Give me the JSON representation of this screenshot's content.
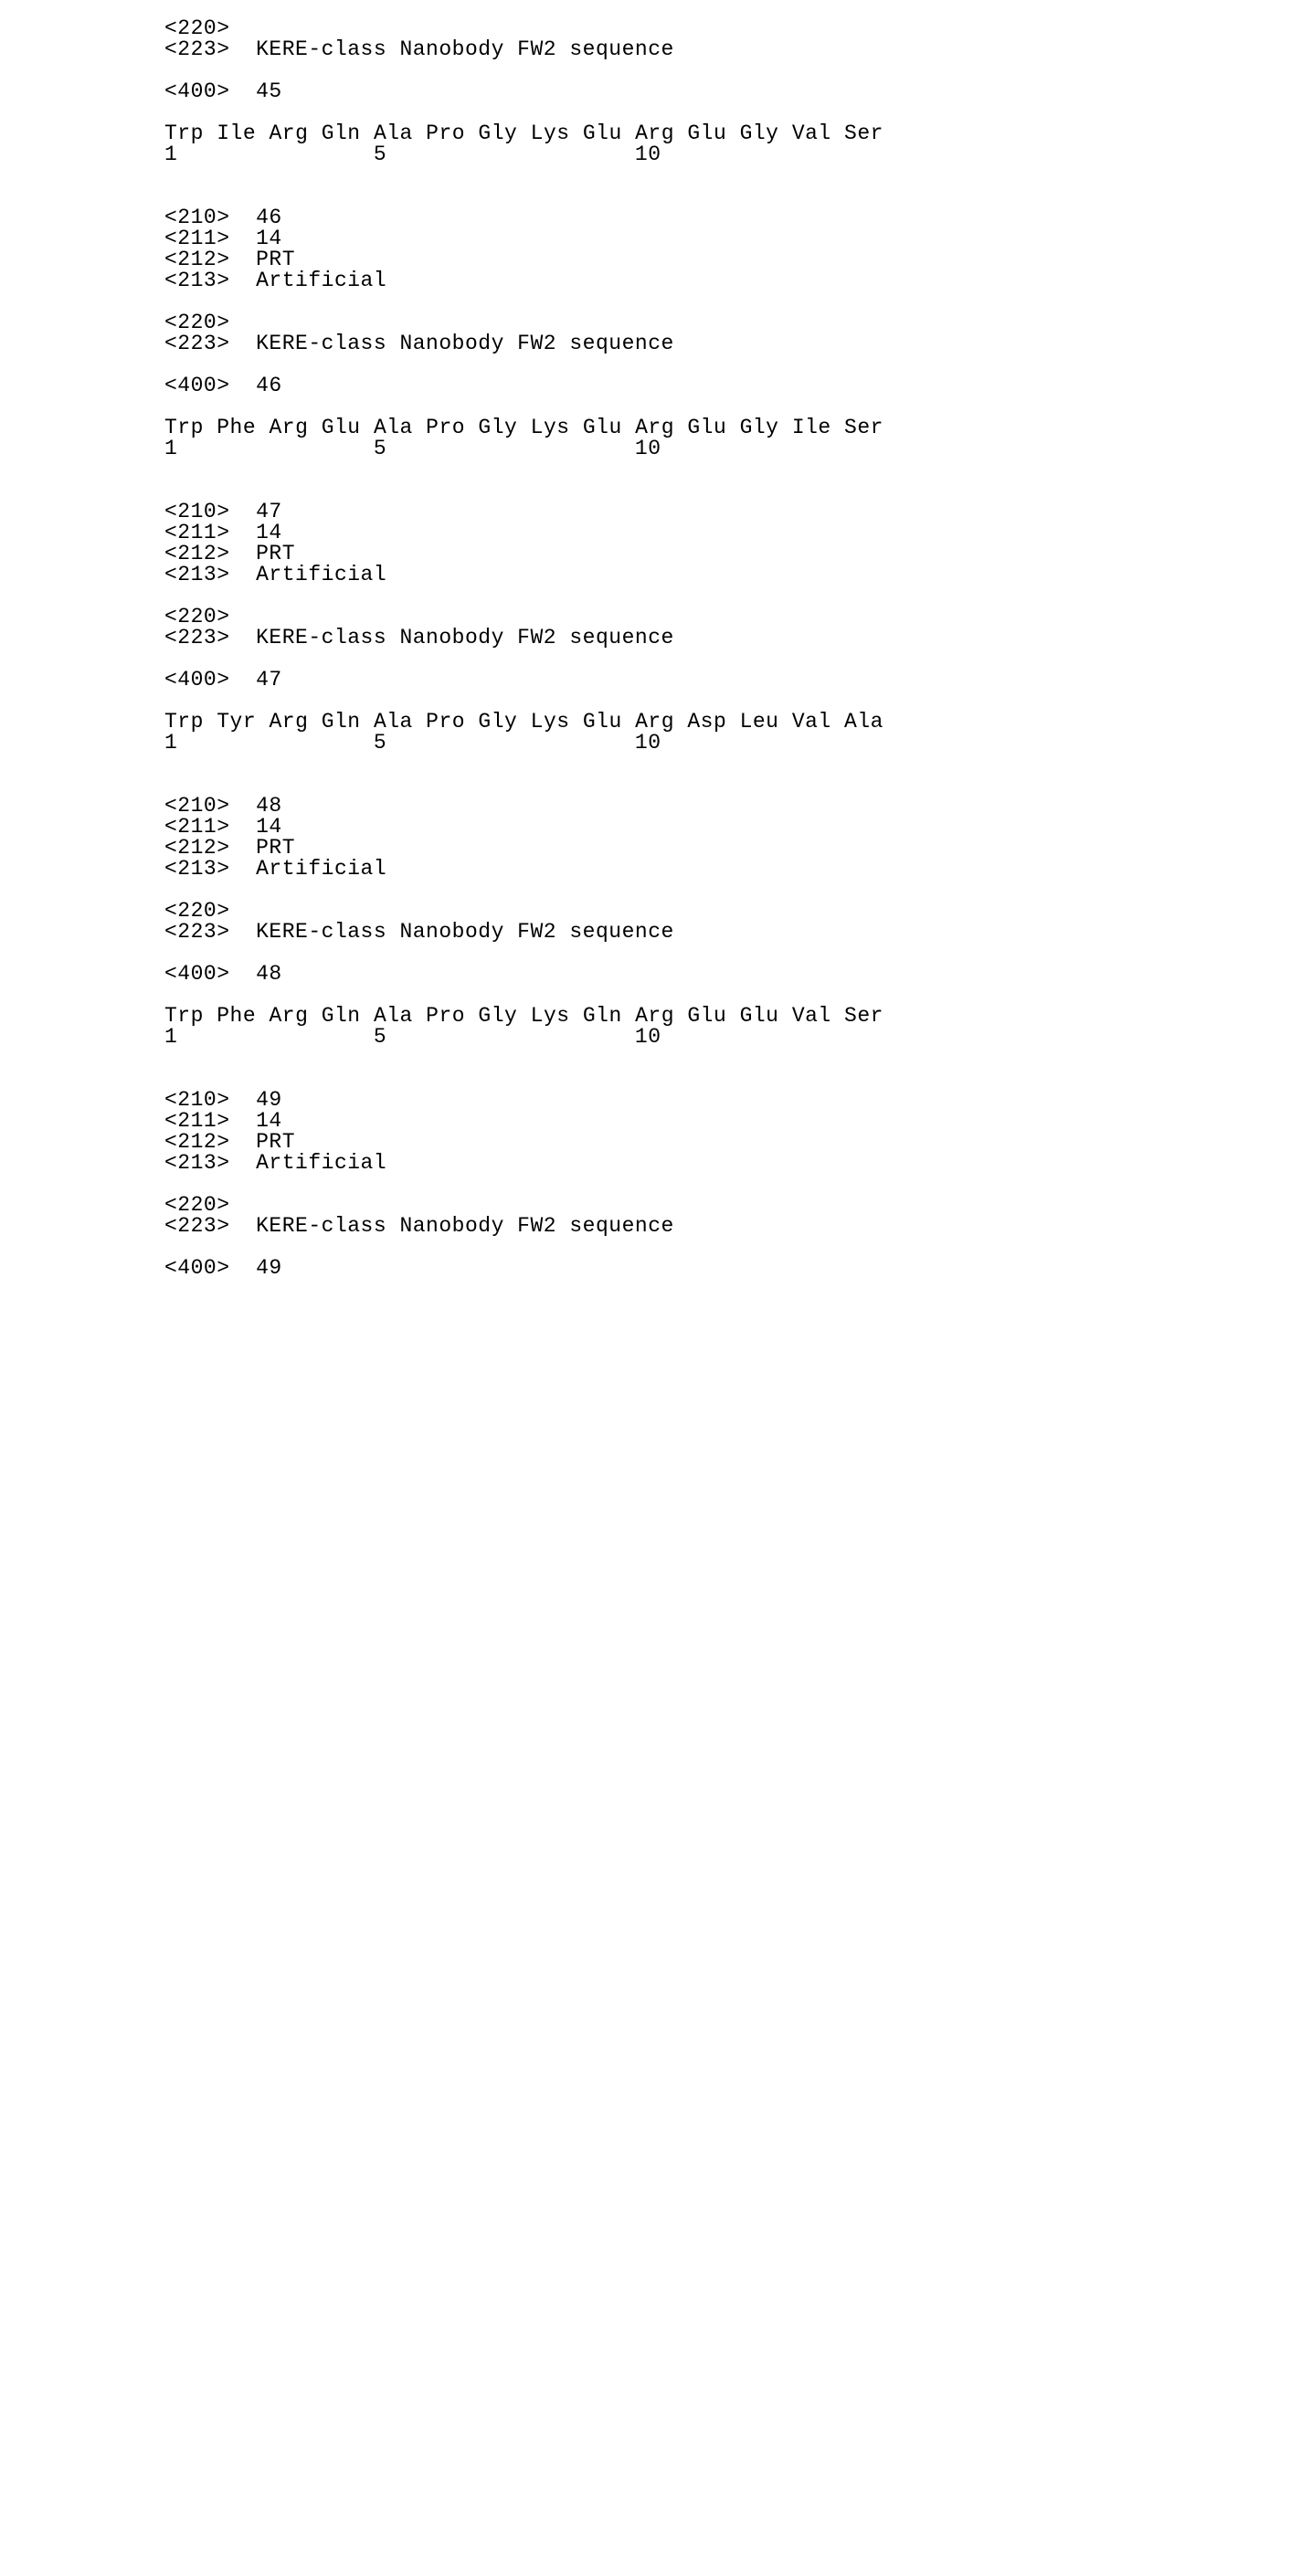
{
  "sequences": [
    {
      "feature_223": "KERE-class Nanobody FW2 sequence",
      "entry_400": "45",
      "residues": [
        "Trp",
        "Ile",
        "Arg",
        "Gln",
        "Ala",
        "Pro",
        "Gly",
        "Lys",
        "Glu",
        "Arg",
        "Glu",
        "Gly",
        "Val",
        "Ser"
      ],
      "markers": {
        "1": "1",
        "5": "5",
        "10": "10"
      }
    },
    {
      "id_210": "46",
      "length_211": "14",
      "moltype_212": "PRT",
      "organism_213": "Artificial",
      "feature_223": "KERE-class Nanobody FW2 sequence",
      "entry_400": "46",
      "residues": [
        "Trp",
        "Phe",
        "Arg",
        "Glu",
        "Ala",
        "Pro",
        "Gly",
        "Lys",
        "Glu",
        "Arg",
        "Glu",
        "Gly",
        "Ile",
        "Ser"
      ],
      "markers": {
        "1": "1",
        "5": "5",
        "10": "10"
      }
    },
    {
      "id_210": "47",
      "length_211": "14",
      "moltype_212": "PRT",
      "organism_213": "Artificial",
      "feature_223": "KERE-class Nanobody FW2 sequence",
      "entry_400": "47",
      "residues": [
        "Trp",
        "Tyr",
        "Arg",
        "Gln",
        "Ala",
        "Pro",
        "Gly",
        "Lys",
        "Glu",
        "Arg",
        "Asp",
        "Leu",
        "Val",
        "Ala"
      ],
      "markers": {
        "1": "1",
        "5": "5",
        "10": "10"
      }
    },
    {
      "id_210": "48",
      "length_211": "14",
      "moltype_212": "PRT",
      "organism_213": "Artificial",
      "feature_223": "KERE-class Nanobody FW2 sequence",
      "entry_400": "48",
      "residues": [
        "Trp",
        "Phe",
        "Arg",
        "Gln",
        "Ala",
        "Pro",
        "Gly",
        "Lys",
        "Gln",
        "Arg",
        "Glu",
        "Glu",
        "Val",
        "Ser"
      ],
      "markers": {
        "1": "1",
        "5": "5",
        "10": "10"
      }
    },
    {
      "id_210": "49",
      "length_211": "14",
      "moltype_212": "PRT",
      "organism_213": "Artificial",
      "feature_223": "KERE-class Nanobody FW2 sequence",
      "entry_400": "49"
    }
  ],
  "tag": {
    "t210": "<210>",
    "t211": "<211>",
    "t212": "<212>",
    "t213": "<213>",
    "t220": "<220>",
    "t223": "<223>",
    "t400": "<400>"
  }
}
